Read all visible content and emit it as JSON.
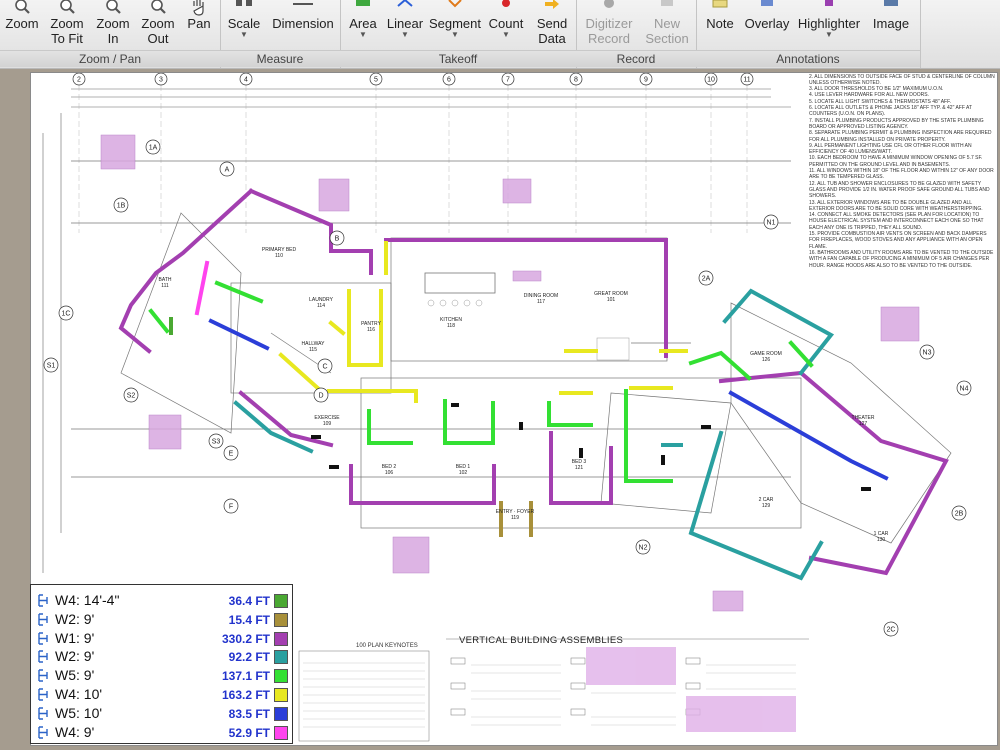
{
  "ribbon": {
    "groups": [
      {
        "label": "Zoom / Pan",
        "buttons": [
          {
            "label": "Zoom",
            "icon": "zoom-icon"
          },
          {
            "label": "Zoom\nTo Fit",
            "icon": "zoom-fit-icon"
          },
          {
            "label": "Zoom\nIn",
            "icon": "zoom-in-icon"
          },
          {
            "label": "Zoom\nOut",
            "icon": "zoom-out-icon"
          },
          {
            "label": "Pan",
            "icon": "hand-icon"
          }
        ]
      },
      {
        "label": "Measure",
        "buttons": [
          {
            "label": "Scale",
            "icon": "scale-icon"
          },
          {
            "label": "Dimension",
            "icon": "dimension-icon"
          }
        ]
      },
      {
        "label": "Takeoff",
        "buttons": [
          {
            "label": "Area",
            "icon": "area-icon"
          },
          {
            "label": "Linear",
            "icon": "linear-icon"
          },
          {
            "label": "Segment",
            "icon": "segment-icon"
          },
          {
            "label": "Count",
            "icon": "count-icon"
          },
          {
            "label": "Send\nData",
            "icon": "send-data-icon"
          }
        ]
      },
      {
        "label": "Record",
        "buttons": [
          {
            "label": "Digitizer\nRecord",
            "icon": "digitizer-icon"
          },
          {
            "label": "New\nSection",
            "icon": "new-section-icon"
          }
        ]
      },
      {
        "label": "Annotations",
        "buttons": [
          {
            "label": "Note",
            "icon": "note-icon"
          },
          {
            "label": "Overlay",
            "icon": "overlay-icon"
          },
          {
            "label": "Highlighter",
            "icon": "highlighter-icon"
          },
          {
            "label": "Image",
            "icon": "image-icon"
          }
        ]
      }
    ]
  },
  "drawing": {
    "column_numbers": [
      "2",
      "3",
      "4",
      "5",
      "6",
      "7",
      "8",
      "9",
      "10",
      "11"
    ],
    "rooms": [
      {
        "name": "PRIMARY BED",
        "number": "110"
      },
      {
        "name": "BATH",
        "number": "111"
      },
      {
        "name": "LAUNDRY",
        "number": "114"
      },
      {
        "name": "PANTRY",
        "number": "116"
      },
      {
        "name": "HALLWAY",
        "number": "115"
      },
      {
        "name": "KITCHEN",
        "number": "118"
      },
      {
        "name": "DINING ROOM",
        "number": "117"
      },
      {
        "name": "GREAT ROOM",
        "number": "101"
      },
      {
        "name": "GAME ROOM",
        "number": "126"
      },
      {
        "name": "EXERCISE",
        "number": "109"
      },
      {
        "name": "BED 2",
        "number": "106"
      },
      {
        "name": "BED 1",
        "number": "102"
      },
      {
        "name": "BED 3",
        "number": "121"
      },
      {
        "name": "ENTRY · FOYER",
        "number": "119"
      },
      {
        "name": "THEATER",
        "number": "127"
      },
      {
        "name": "2 CAR",
        "number": "129"
      },
      {
        "name": "1 CAR",
        "number": "130"
      }
    ],
    "grid_refs": [
      "A",
      "B",
      "C",
      "D",
      "E",
      "F",
      "1A",
      "1B",
      "1C",
      "S1",
      "S2",
      "S3",
      "N1",
      "N2",
      "N3",
      "N4",
      "2A",
      "2B",
      "2C"
    ],
    "plan_keynotes_title": "100 PLAN KEYNOTES",
    "assemblies_title": "VERTICAL BUILDING ASSEMBLIES",
    "general_notes": [
      "ALL GRID LINES TO OUTSIDE FACE OF STUD UNLESS OTHERWISE NOTED.",
      "ALL DIMENSIONS TO OUTSIDE FACE OF STUD & CENTERLINE OF COLUMN UNLESS OTHERWISE NOTED.",
      "ALL DOOR THRESHOLDS TO BE 1/2\" MAXIMUM U.O.N.",
      "USE LEVER HARDWARE FOR ALL NEW DOORS.",
      "LOCATE ALL LIGHT SWITCHES & THERMOSTATS 48\" AFF.",
      "LOCATE ALL OUTLETS & PHONE JACKS 18\" AFF TYP. & 42\" AFF AT COUNTERS (U.O.N. ON PLANS).",
      "INSTALL PLUMBING PRODUCTS APPROVED BY THE STATE PLUMBING BOARD OR APPROVED LISTING AGENCY.",
      "SEPARATE PLUMBING PERMIT & PLUMBING INSPECTION ARE REQUIRED FOR ALL PLUMBING INSTALLED ON PRIVATE PROPERTY.",
      "ALL PERMANENT LIGHTING USE CFL OR OTHER FLOOR WITH AN EFFICIENCY OF 40 LUMENS/WATT.",
      "EACH BEDROOM TO HAVE A MINIMUM WINDOW OPENING OF 5.7 SF. PERMITTED ON THE GROUND LEVEL AND IN BASEMENTS.",
      "ALL WINDOWS WITHIN 18\" OF THE FLOOR AND WITHIN 12\" OF ANY DOOR ARE TO BE TEMPERED GLASS.",
      "ALL TUB AND SHOWER ENCLOSURES TO BE GLAZED WITH SAFETY GLASS AND PROVIDE 1/2 IN. WATER PROOF SAFE GROUND ALL TUBS AND SHOWERS.",
      "ALL EXTERIOR WINDOWS ARE TO BE DOUBLE GLAZED AND ALL EXTERIOR DOORS ARE TO BE SOLID CORE WITH WEATHERSTRIPPING.",
      "CONNECT ALL SMOKE DETECTORS (SEE PLAN FOR LOCATION) TO HOUSE ELECTRICAL SYSTEM AND INTERCONNECT EACH ONE SO THAT EACH ANY ONE IS TRIPPED, THEY ALL SOUND.",
      "PROVIDE COMBUSTION AIR VENTS ON SCREEN AND BACK DAMPERS FOR FIREPLACES, WOOD STOVES AND ANY APPLIANCE WITH AN OPEN FLAME.",
      "BATHROOMS AND UTILITY ROOMS ARE TO BE VENTED TO THE OUTSIDE WITH A FAN CAPABLE OF PRODUCING A MINIMUM OF 5 AIR CHANGES PER HOUR. RANGE HOODS ARE ALSO TO BE VENTED TO THE OUTSIDE."
    ]
  },
  "legend": [
    {
      "name": "W4: 14'-4\"",
      "value": "36.4 FT",
      "color": "#4aa832"
    },
    {
      "name": "W2: 9'",
      "value": "15.4 FT",
      "color": "#a8903a"
    },
    {
      "name": "W1: 9'",
      "value": "330.2 FT",
      "color": "#a33fb0"
    },
    {
      "name": "W2: 9'",
      "value": "92.2 FT",
      "color": "#2aa0a0"
    },
    {
      "name": "W5: 9'",
      "value": "137.1 FT",
      "color": "#33e033"
    },
    {
      "name": "W4: 10'",
      "value": "163.2 FT",
      "color": "#e8e820"
    },
    {
      "name": "W5: 10'",
      "value": "83.5 FT",
      "color": "#2b3ed8"
    },
    {
      "name": "W4: 9'",
      "value": "52.9 FT",
      "color": "#ff44ee"
    }
  ]
}
